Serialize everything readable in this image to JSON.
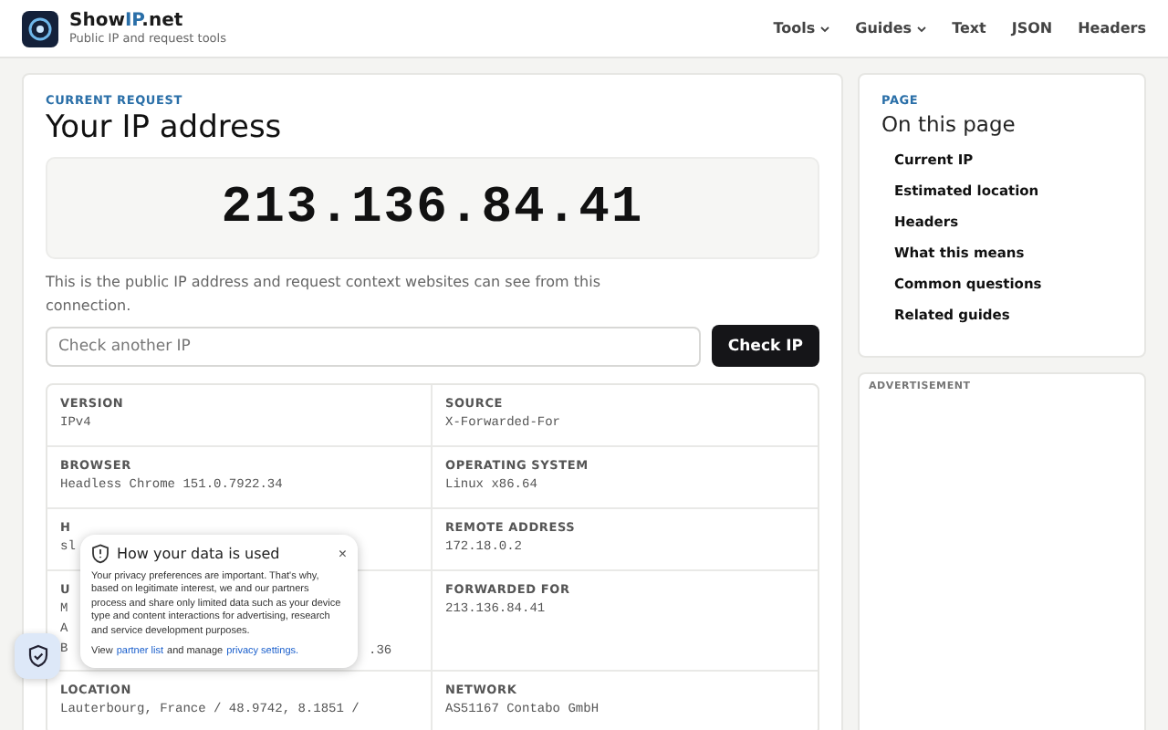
{
  "header": {
    "brand": {
      "prefix": "Show",
      "highlight": "IP",
      "suffix": ".net"
    },
    "tagline": "Public IP and request tools",
    "nav": [
      {
        "label": "Tools",
        "dropdown": true
      },
      {
        "label": "Guides",
        "dropdown": true
      },
      {
        "label": "Text",
        "dropdown": false
      },
      {
        "label": "JSON",
        "dropdown": false
      },
      {
        "label": "Headers",
        "dropdown": false
      }
    ]
  },
  "main": {
    "eyebrow": "CURRENT REQUEST",
    "title": "Your IP address",
    "ip": "213.136.84.41",
    "description": "This is the public IP address and request context websites can see from this connection.",
    "search": {
      "placeholder": "Check another IP"
    },
    "button": "Check IP",
    "details": [
      {
        "label": "VERSION",
        "value_lines": [
          "IPv4"
        ]
      },
      {
        "label": "SOURCE",
        "value_lines": [
          "X-Forwarded-For"
        ]
      },
      {
        "label": "BROWSER",
        "value_lines": [
          "Headless Chrome 151.0.7922.34"
        ]
      },
      {
        "label": "OPERATING SYSTEM",
        "value_lines": [
          "Linux x86.64"
        ]
      },
      {
        "label": "H",
        "value_lines": [
          "sl"
        ]
      },
      {
        "label": "REMOTE ADDRESS",
        "value_lines": [
          "172.18.0.2"
        ]
      },
      {
        "label": "U",
        "value_lines": [
          "M",
          "A",
          "B"
        ],
        "tail": ".36"
      },
      {
        "label": "FORWARDED FOR",
        "value_lines": [
          "213.136.84.41"
        ]
      },
      {
        "label": "LOCATION",
        "value_lines": [
          "Lauterbourg, France / 48.9742, 8.1851 /"
        ]
      },
      {
        "label": "NETWORK",
        "value_lines": [
          "AS51167 Contabo GmbH"
        ]
      }
    ]
  },
  "sidebar": {
    "eyebrow": "PAGE",
    "title": "On this page",
    "links": [
      "Current IP",
      "Estimated location",
      "Headers",
      "What this means",
      "Common questions",
      "Related guides"
    ]
  },
  "ad": {
    "label": "ADVERTISEMENT"
  },
  "consent": {
    "title": "How your data is used",
    "close": "×",
    "body": "Your privacy preferences are important. That's why, based on legitimate interest, we and our partners process and share only limited data such as your device type and content interactions for advertising, research and service development purposes.",
    "footer": [
      {
        "kind": "text",
        "text": "View"
      },
      {
        "kind": "link",
        "text": "partner list"
      },
      {
        "kind": "text",
        "text": "and manage"
      },
      {
        "kind": "link",
        "text": "privacy settings."
      }
    ]
  }
}
